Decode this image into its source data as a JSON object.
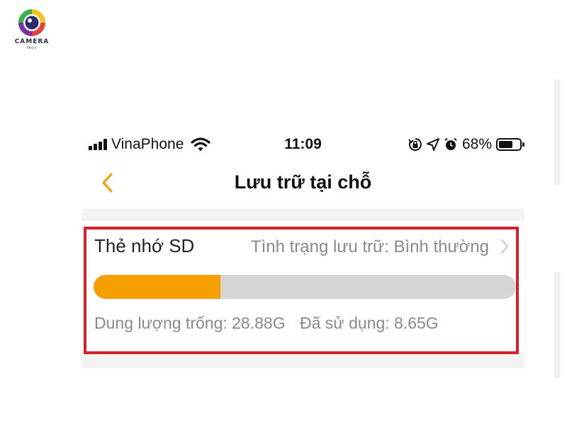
{
  "brand": {
    "name": "CAMERA",
    "sub": "IMOU"
  },
  "status_bar": {
    "carrier": "VinaPhone",
    "time": "11:09",
    "battery_percent_label": "68%",
    "battery_level": 0.68,
    "icons": [
      "signal-icon",
      "wifi-icon",
      "rotation-lock-icon",
      "location-arrow-icon",
      "alarm-clock-icon",
      "battery-icon"
    ]
  },
  "nav": {
    "back_icon": "chevron-left-icon",
    "title": "Lưu trữ tại chỗ"
  },
  "storage": {
    "label": "Thẻ nhớ SD",
    "status": "Tình trạng lưu trữ: Bình thường",
    "free_text": "Dung lượng trống: 28.88G",
    "used_text": "Đã sử dụng: 8.65G",
    "used_fraction": 0.3,
    "colors": {
      "accent": "#f59f00",
      "track": "#d5d5d5",
      "highlight": "#d42029"
    }
  }
}
